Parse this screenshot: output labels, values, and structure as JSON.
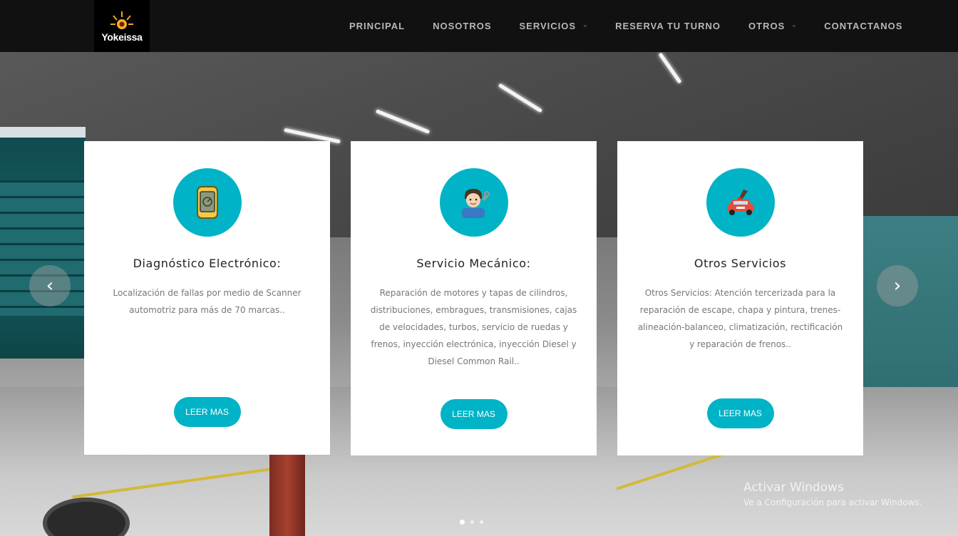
{
  "header": {
    "logo_text": "Yokeissa",
    "nav": [
      {
        "label": "PRINCIPAL",
        "dropdown": false
      },
      {
        "label": "NOSOTROS",
        "dropdown": false
      },
      {
        "label": "SERVICIOS",
        "dropdown": true
      },
      {
        "label": "RESERVA TU TURNO",
        "dropdown": false
      },
      {
        "label": "OTROS",
        "dropdown": true
      },
      {
        "label": "CONTACTANOS",
        "dropdown": false
      }
    ]
  },
  "cards": [
    {
      "icon": "diagnostic-scanner-icon",
      "title": "Diagnóstico Electrónico:",
      "text": "Localización de fallas por medio de Scanner automotriz para más de 70 marcas..",
      "button": "LEER MAS"
    },
    {
      "icon": "mechanic-icon",
      "title": "Servicio Mecánico:",
      "text": "Reparación de motores y tapas de cilindros, distribuciones, embragues, transmisiones, cajas de velocidades, turbos, servicio de ruedas y frenos, inyección electrónica, inyección Diesel y Diesel Common Rail..",
      "button": "LEER MAS"
    },
    {
      "icon": "car-paint-icon",
      "title": "Otros Servicios",
      "text": "Otros Servicios: Atención tercerizada para la reparación de escape, chapa y pintura, trenes-alineación-balanceo, climatización, rectificación y reparación de frenos..",
      "button": "LEER MAS"
    }
  ],
  "carousel": {
    "prev_symbol": "‹",
    "next_symbol": "›",
    "slide_count": 3,
    "active_slide": 1
  },
  "watermark": {
    "title": "Activar Windows",
    "subtitle": "Ve a Configuración para activar Windows."
  },
  "colors": {
    "accent": "#00b3c6",
    "navbar": "#111111",
    "nav_text": "#b7b7b7"
  }
}
